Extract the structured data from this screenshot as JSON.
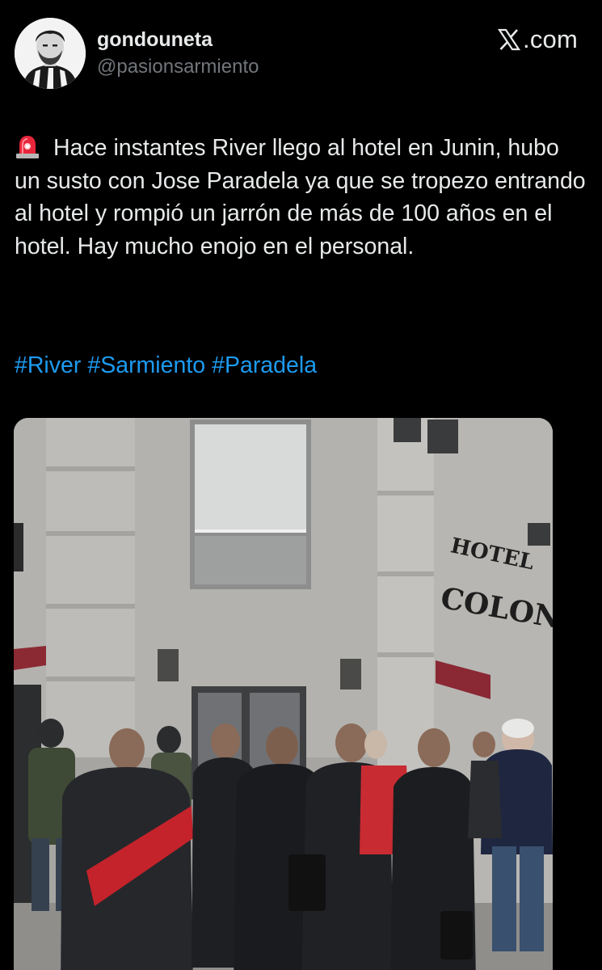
{
  "header": {
    "display_name": "gondouneta",
    "handle": "@pasionsarmiento",
    "brand": ".com",
    "avatar_icon": "user-avatar-icon",
    "brand_icon": "x-logo-icon"
  },
  "tweet": {
    "emoji_icon": "police-siren-icon",
    "text": "Hace instantes River llego al hotel en Junin, hubo un susto con Jose Paradela ya que se tropezo entrando al hotel y rompió un jarrón de más de 100 años en el hotel. Hay mucho enojo en el personal.",
    "hashtags": [
      "#River",
      "#Sarmiento",
      "#Paradela"
    ]
  },
  "media": {
    "sign_line1": "HOTEL",
    "sign_line2": "COLON"
  },
  "colors": {
    "background": "#000000",
    "text": "#e7e9ea",
    "secondary": "#71767b",
    "link": "#1d9bf0"
  }
}
